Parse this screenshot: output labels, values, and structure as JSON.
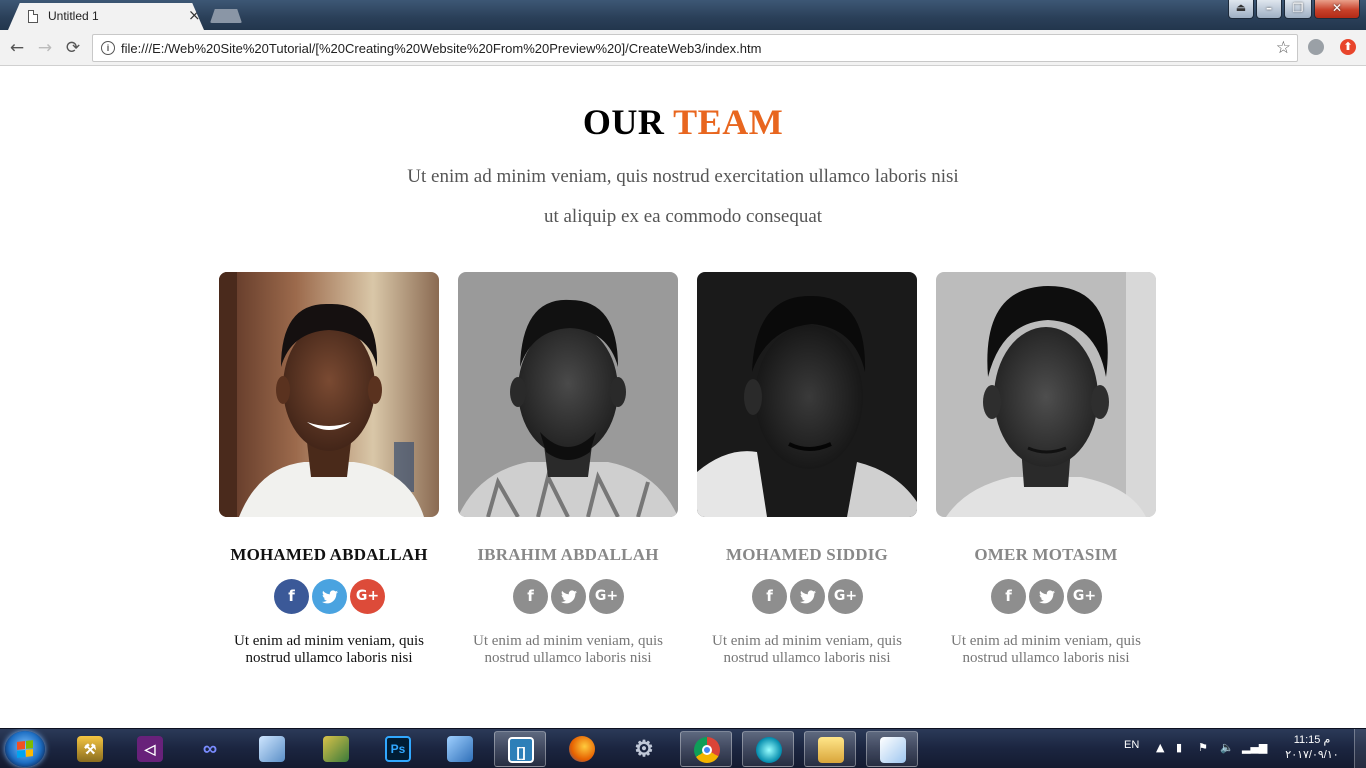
{
  "browser": {
    "tab_title": "Untitled 1",
    "tab_close": "×",
    "address": "file:///E:/Web%20Site%20Tutorial/[%20Creating%20Website%20From%20Preview%20]/CreateWeb3/index.htm",
    "nav": {
      "back": "←",
      "forward": "→",
      "reload": "⟳",
      "info": "i",
      "star": "☆"
    }
  },
  "page": {
    "heading_main": "OUR",
    "heading_accent": "TEAM",
    "intro_line1": "Ut enim ad minim veniam, quis nostrud exercitation ullamco laboris nisi",
    "intro_line2": "ut aliquip ex ea commodo consequat",
    "accent_color": "#e8661f",
    "team": [
      {
        "name": "MOHAMED ABDALLAH",
        "desc": "Ut enim ad minim veniam, quis nostrud ullamco laboris nisi",
        "active": true,
        "photo": "color"
      },
      {
        "name": "IBRAHIM ABDALLAH",
        "desc": "Ut enim ad minim veniam, quis nostrud ullamco laboris nisi",
        "active": false,
        "photo": "grayscale"
      },
      {
        "name": "MOHAMED SIDDIG",
        "desc": "Ut enim ad minim veniam, quis nostrud ullamco laboris nisi",
        "active": false,
        "photo": "grayscale"
      },
      {
        "name": "OMER MOTASIM",
        "desc": "Ut enim ad minim veniam, quis nostrud ullamco laboris nisi",
        "active": false,
        "photo": "grayscale"
      }
    ],
    "social": {
      "facebook": "f",
      "twitter": "🐦",
      "googleplus": "G+"
    },
    "social_colors": {
      "facebook": "#3b5998",
      "twitter": "#4aa3e0",
      "googleplus": "#dd4b39",
      "inactive": "#8e8e8e"
    }
  },
  "taskbar": {
    "apps": [
      "toolbox-icon",
      "visual-studio-icon",
      "infinity-icon",
      "cube-icon",
      "app-icon",
      "photoshop-icon",
      "notebook-icon",
      "brackets-icon",
      "firefox-icon",
      "gears-icon",
      "chrome-icon",
      "media-player-icon",
      "file-explorer-icon",
      "paint-icon"
    ],
    "ps_label": "Ps",
    "lang": "EN",
    "time": "11:15 م",
    "date": "٢٠١٧/٠٩/١٠"
  }
}
